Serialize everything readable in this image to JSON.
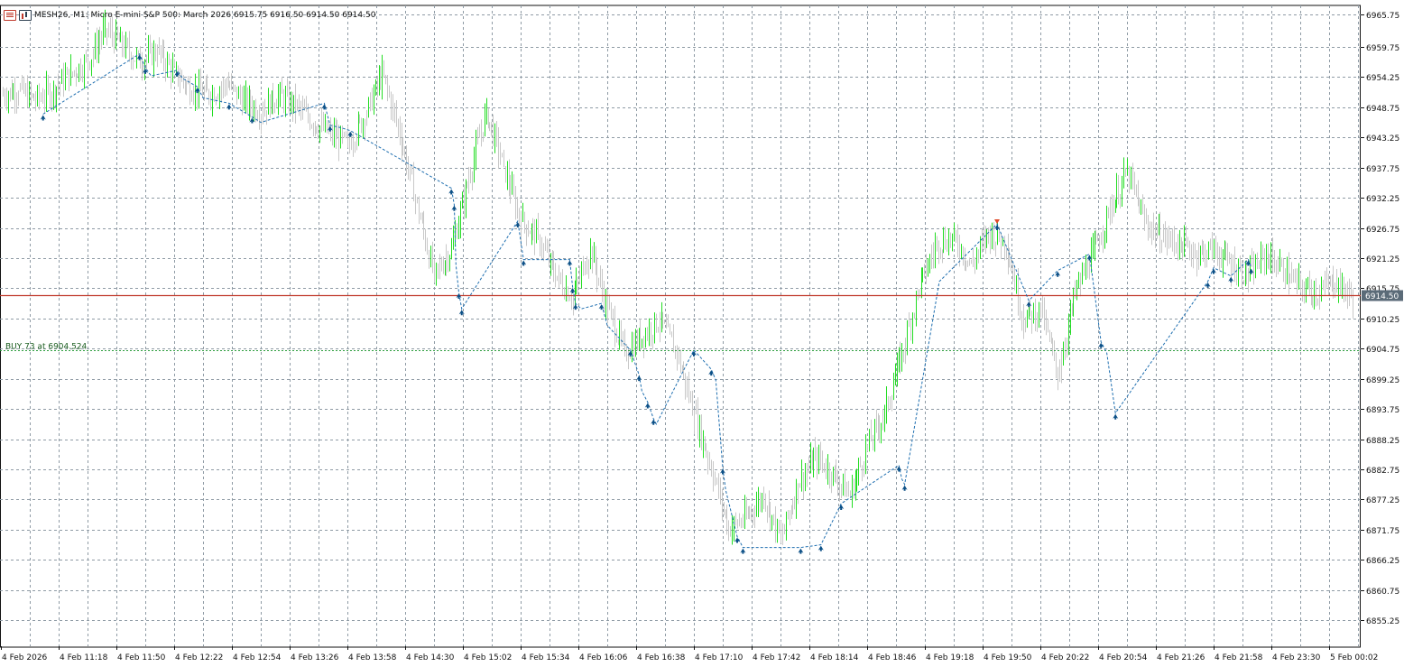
{
  "header": {
    "menu_icon": "chart-menu-icon",
    "chart_icon": "bar-chart-icon",
    "title": "MESH26, M1:  Micro E-mini S&P 500: March 2026  6915.75 6916.50 6914.50 6914.50"
  },
  "colors": {
    "background": "#ffffff",
    "grid": "#8f9ba5",
    "up_candle": "#22dd22",
    "down_candle": "#c8c8c8",
    "price_line": "#c0392b",
    "trade_line": "#1f6fb0",
    "trade_arrow": "#0b4f86",
    "sell_arrow": "#e04a2a",
    "order_line": "#2e9e3e",
    "price_label_bg": "#5b6b78"
  },
  "current_price": {
    "value": 6914.5,
    "label": "6914.50"
  },
  "order": {
    "price": 6904.524,
    "label": "BUY 73 at 6904.524"
  },
  "chart_data": {
    "type": "line",
    "title": "MESH26, M1:  Micro E-mini S&P 500: March 2026",
    "ylim": [
      6850.5,
      6967.0
    ],
    "y_ticks": [
      "6965.75",
      "6959.75",
      "6954.25",
      "6948.75",
      "6943.25",
      "6937.75",
      "6932.25",
      "6926.75",
      "6921.25",
      "6915.75",
      "6910.25",
      "6904.75",
      "6899.25",
      "6893.75",
      "6888.25",
      "6882.75",
      "6877.25",
      "6871.75",
      "6866.25",
      "6860.75",
      "6855.25"
    ],
    "x_ticks": [
      "4 Feb 2026",
      "4 Feb 11:18",
      "4 Feb 11:50",
      "4 Feb 12:22",
      "4 Feb 12:54",
      "4 Feb 13:26",
      "4 Feb 13:58",
      "4 Feb 14:30",
      "4 Feb 15:02",
      "4 Feb 15:34",
      "4 Feb 16:06",
      "4 Feb 16:38",
      "4 Feb 17:10",
      "4 Feb 17:42",
      "4 Feb 18:14",
      "4 Feb 18:46",
      "4 Feb 19:18",
      "4 Feb 19:50",
      "4 Feb 20:22",
      "4 Feb 20:54",
      "4 Feb 21:26",
      "4 Feb 21:58",
      "4 Feb 23:30",
      "5 Feb 00:02"
    ],
    "x_range_index": [
      0,
      23.6
    ],
    "price_series": {
      "name": "MESH26 M1",
      "x": [
        0,
        0.3,
        0.6,
        0.9,
        1.2,
        1.5,
        1.8,
        2.1,
        2.4,
        2.7,
        3.0,
        3.3,
        3.6,
        3.9,
        4.2,
        4.5,
        4.8,
        5.1,
        5.4,
        5.7,
        6.0,
        6.3,
        6.6,
        6.9,
        7.2,
        7.5,
        7.8,
        8.1,
        8.4,
        8.7,
        9.0,
        9.3,
        9.6,
        9.9,
        10.2,
        10.5,
        10.8,
        11.1,
        11.4,
        11.7,
        12.0,
        12.3,
        12.6,
        12.9,
        13.2,
        13.5,
        13.8,
        14.1,
        14.4,
        14.7,
        15.0,
        15.3,
        15.6,
        15.9,
        16.2,
        16.5,
        16.8,
        17.1,
        17.4,
        17.7,
        18.0,
        18.3,
        18.6,
        18.9,
        19.2,
        19.5,
        19.8,
        20.1,
        20.4,
        20.7,
        21.0,
        21.3,
        21.6,
        21.9,
        22.2,
        22.5,
        22.8,
        23.1,
        23.4
      ],
      "close": [
        6951,
        6952,
        6950,
        6952,
        6955,
        6957,
        6963,
        6960,
        6957,
        6959,
        6955,
        6952,
        6951,
        6953,
        6950,
        6948,
        6951,
        6949,
        6946,
        6944,
        6942,
        6947,
        6955,
        6944,
        6931,
        6918,
        6923,
        6936,
        6948,
        6938,
        6928,
        6925,
        6918,
        6914,
        6923,
        6912,
        6904,
        6907,
        6910,
        6904,
        6893,
        6883,
        6872,
        6874,
        6878,
        6870,
        6880,
        6885,
        6882,
        6878,
        6887,
        6893,
        6904,
        6916,
        6924,
        6925,
        6920,
        6926,
        6924,
        6910,
        6912,
        6900,
        6915,
        6922,
        6930,
        6937,
        6928,
        6925,
        6924,
        6922,
        6923,
        6920,
        6918,
        6922,
        6919,
        6916,
        6915,
        6917,
        6914
      ]
    },
    "trade_path": {
      "name": "trades",
      "x": [
        0.73,
        2.4,
        2.5,
        2.6,
        3.05,
        3.15,
        3.4,
        3.5,
        3.95,
        4.35,
        4.5,
        5.6,
        5.7,
        5.9,
        6.05,
        7.8,
        7.85,
        7.88,
        7.93,
        7.98,
        8.95,
        9.05,
        9.85,
        9.9,
        9.95,
        10.05,
        10.4,
        10.5,
        10.9,
        11.05,
        11.1,
        11.2,
        11.3,
        11.35,
        12.0,
        12.3,
        12.38,
        12.5,
        12.55,
        12.75,
        12.85,
        12.95,
        13.85,
        14.2,
        14.55,
        15.55,
        15.6,
        15.65,
        16.25,
        17.25,
        17.8,
        18.3,
        18.85,
        19.05,
        19.15,
        19.3,
        20.9,
        21.0,
        21.3,
        21.6,
        21.65
      ],
      "y": [
        6947.5,
        6958.5,
        6956,
        6954.5,
        6955.5,
        6954,
        6952.5,
        6950.5,
        6949.5,
        6947,
        6946,
        6949.5,
        6945.5,
        6945,
        6944.5,
        6934,
        6931,
        6920,
        6915,
        6912,
        6928,
        6921,
        6921,
        6916,
        6913,
        6912,
        6913,
        6909,
        6904.5,
        6900,
        6897,
        6895,
        6892,
        6891,
        6904.5,
        6901,
        6899,
        6883,
        6879,
        6870.5,
        6868.5,
        6868.5,
        6868.5,
        6869,
        6876.5,
        6883.5,
        6881,
        6880,
        6917,
        6927.5,
        6913.5,
        6919,
        6922,
        6906,
        6904,
        6893,
        6917,
        6919.5,
        6918,
        6921,
        6919.5
      ],
      "markers": [
        0.73,
        2.4,
        2.5,
        3.05,
        3.4,
        3.95,
        4.35,
        5.6,
        5.7,
        6.05,
        7.8,
        7.85,
        7.93,
        7.98,
        8.95,
        9.05,
        9.85,
        9.9,
        9.95,
        10.4,
        10.9,
        11.05,
        11.2,
        11.3,
        12.0,
        12.3,
        12.5,
        12.75,
        12.85,
        13.85,
        14.2,
        14.55,
        15.55,
        15.65,
        17.25,
        17.8,
        18.3,
        18.85,
        19.05,
        19.3,
        20.9,
        21.0,
        21.3,
        21.6,
        21.65
      ],
      "sell_marker": [
        17.25,
        6927.5
      ]
    }
  }
}
